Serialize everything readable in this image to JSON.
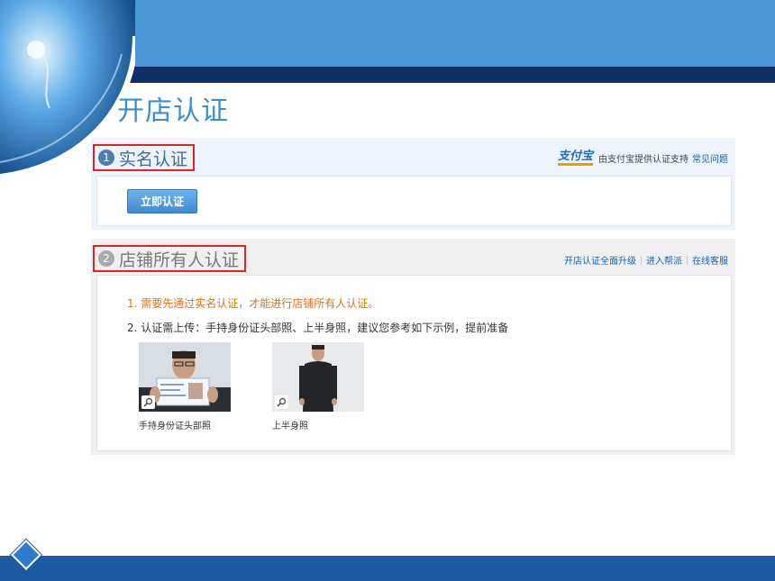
{
  "slide": {
    "title": "开店认证"
  },
  "section1": {
    "number": "1",
    "title": "实名认证",
    "provider_logo": "支付宝",
    "provider_text": "由支付宝提供认证支持",
    "faq_link": "常见问题",
    "verify_button": "立即认证"
  },
  "section2": {
    "number": "2",
    "title": "店铺所有人认证",
    "links": [
      "开店认证全面升级",
      "进入帮派",
      "在线客服"
    ],
    "note1": "1. 需要先通过实名认证，才能进行店铺所有人认证。",
    "note2": "2. 认证需上传：手持身份证头部照、上半身照，建议您参考如下示例，提前准备",
    "photos": [
      {
        "caption": "手持身份证头部照",
        "icon": "zoom-icon"
      },
      {
        "caption": "上半身照",
        "icon": "zoom-icon"
      }
    ]
  },
  "colors": {
    "title_blue": "#3b8ed0",
    "highlight_red": "#e02323",
    "note_orange": "#e3700f",
    "band_blue": "#4b97d6",
    "band_navy": "#0e2f63"
  }
}
